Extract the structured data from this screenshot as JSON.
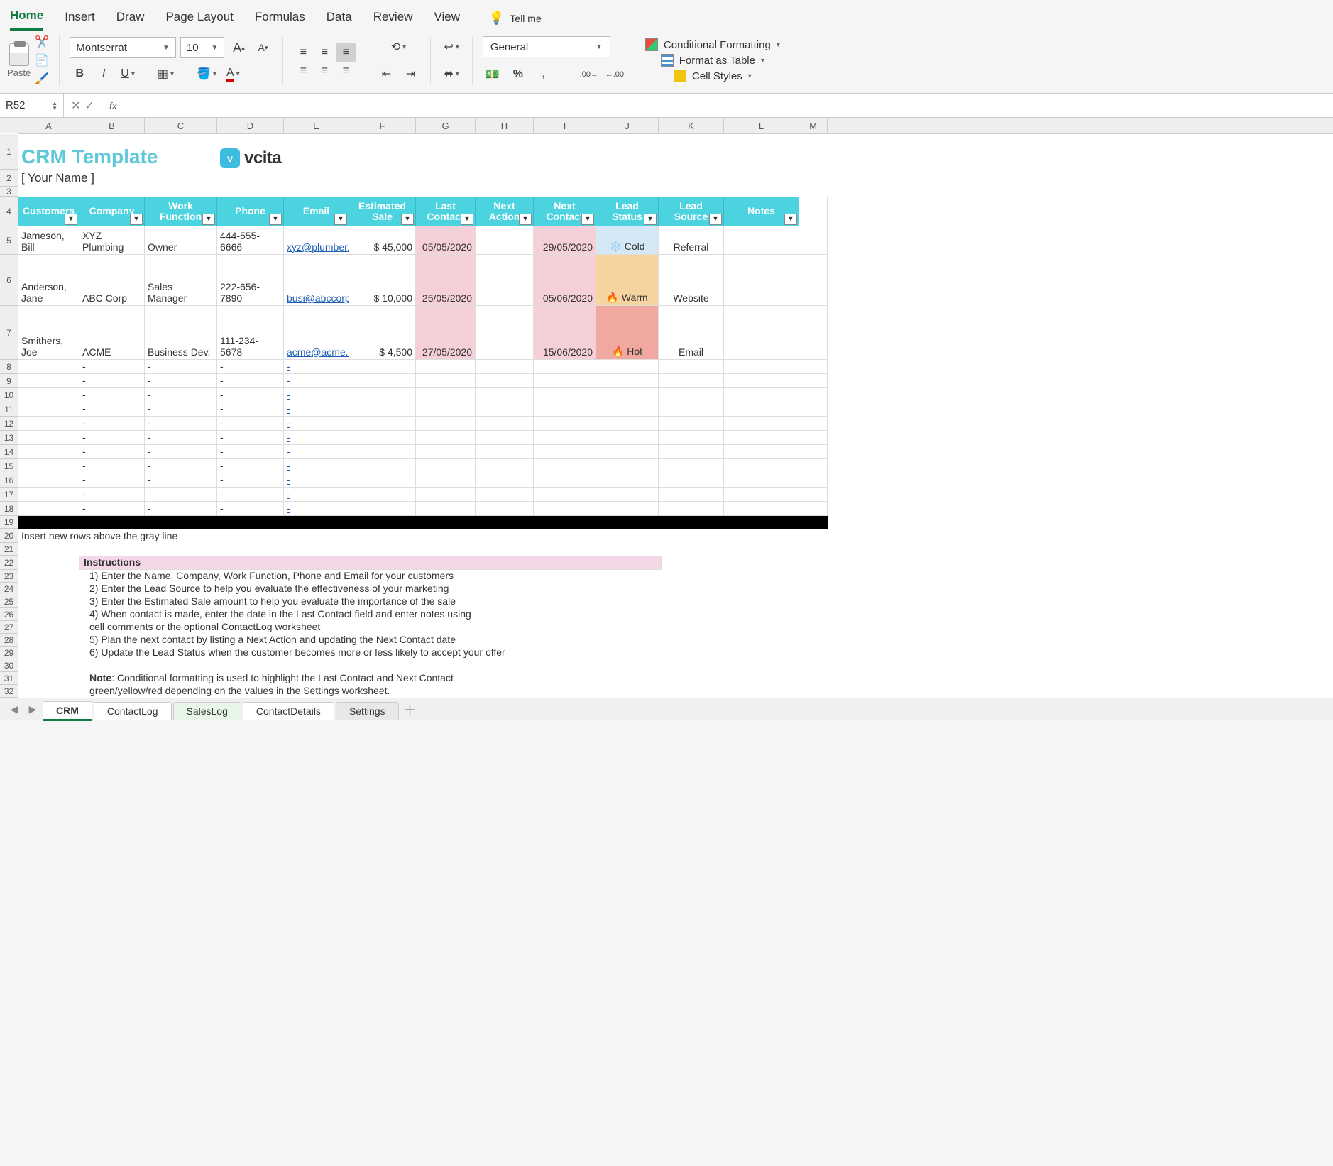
{
  "tabs": [
    "Home",
    "Insert",
    "Draw",
    "Page Layout",
    "Formulas",
    "Data",
    "Review",
    "View"
  ],
  "tellme": "Tell me",
  "paste": "Paste",
  "font": {
    "name": "Montserrat",
    "size": "10"
  },
  "number_format": "General",
  "styles": {
    "cf": "Conditional Formatting",
    "fat": "Format as Table",
    "cs": "Cell Styles"
  },
  "name_box": "R52",
  "fx": "fx",
  "columns": [
    "A",
    "B",
    "C",
    "D",
    "E",
    "F",
    "G",
    "H",
    "I",
    "J",
    "K",
    "L",
    "M"
  ],
  "title": "CRM Template",
  "logo": "vcita",
  "your_name": "[ Your Name ]",
  "headers": [
    "Customers",
    "Company",
    "Work Function",
    "Phone",
    "Email",
    "Estimated Sale",
    "Last Contact",
    "Next Action",
    "Next Contact",
    "Lead Status",
    "Lead Source",
    "Notes"
  ],
  "rows": [
    {
      "n": "5",
      "name": "Jameson, Bill",
      "company": "XYZ Plumbing",
      "func": "Owner",
      "phone": "444-555-6666",
      "email": "xyz@plumber.com",
      "sale": "$     45,000",
      "last": "05/05/2020",
      "action": "",
      "next": "29/05/2020",
      "status": "❄️ Cold",
      "status_cls": "cold-cell",
      "source": "Referral",
      "notes": ""
    },
    {
      "n": "6",
      "name": "Anderson, Jane",
      "company": "ABC Corp",
      "func": "Sales Manager",
      "phone": "222-656-7890",
      "email": "busi@abccorp.com",
      "sale": "$      10,000",
      "last": "25/05/2020",
      "action": "",
      "next": "05/06/2020",
      "status": "🔥 Warm",
      "status_cls": "warm-cell",
      "source": "Website",
      "notes": ""
    },
    {
      "n": "7",
      "name": "Smithers, Joe",
      "company": "ACME",
      "func": "Business Dev.",
      "phone": "111-234-5678",
      "email": "acme@acme.com",
      "sale": "$       4,500",
      "last": "27/05/2020",
      "action": "",
      "next": "15/06/2020",
      "status": "🔥 Hot",
      "status_cls": "hot-cell",
      "source": "Email",
      "notes": ""
    }
  ],
  "empty_rows": [
    "8",
    "9",
    "10",
    "11",
    "12",
    "13",
    "14",
    "15",
    "16",
    "17",
    "18"
  ],
  "dash": "-",
  "insert_msg": "Insert new rows above the gray line",
  "instr_title": "Instructions",
  "instructions": [
    "1) Enter the Name, Company, Work Function, Phone and Email for your customers",
    "2) Enter the Lead Source to help you evaluate the effectiveness of your marketing",
    "3) Enter the Estimated Sale amount to help you evaluate the importance of the sale",
    "4) When contact is made, enter the date in the Last Contact field and enter notes using",
    "cell comments or the optional ContactLog worksheet",
    "5) Plan the next contact by listing a Next Action and updating the Next Contact date",
    "6) Update the Lead Status when the customer becomes more or less likely to accept your offer"
  ],
  "note_label": "Note",
  "note1": ": Conditional formatting is used to highlight the Last Contact and Next Contact",
  "note2": "green/yellow/red depending on the values in the Settings worksheet.",
  "sheets": [
    "CRM",
    "ContactLog",
    "SalesLog",
    "ContactDetails",
    "Settings"
  ]
}
